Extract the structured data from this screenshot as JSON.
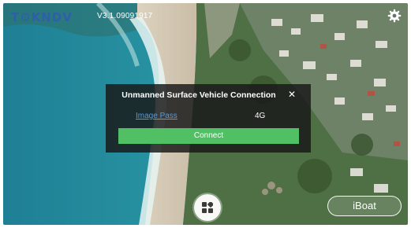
{
  "header": {
    "logo_text": "T⚙KNDV",
    "version": "V3.1.09091917",
    "settings_icon": "gear-icon"
  },
  "dialog": {
    "title": "Unmanned Surface Vehicle Connection",
    "close_label": "✕",
    "image_pass_label": "Image Pass",
    "network_value": "4G",
    "connect_label": "Connect"
  },
  "bottom": {
    "apps_icon": "grid-icon",
    "mode_label": "iBoat"
  },
  "colors": {
    "accent_green": "#51c064",
    "link_blue": "#4f9de8",
    "logo_blue": "#2f5fa8",
    "dialog_bg": "#191919"
  }
}
